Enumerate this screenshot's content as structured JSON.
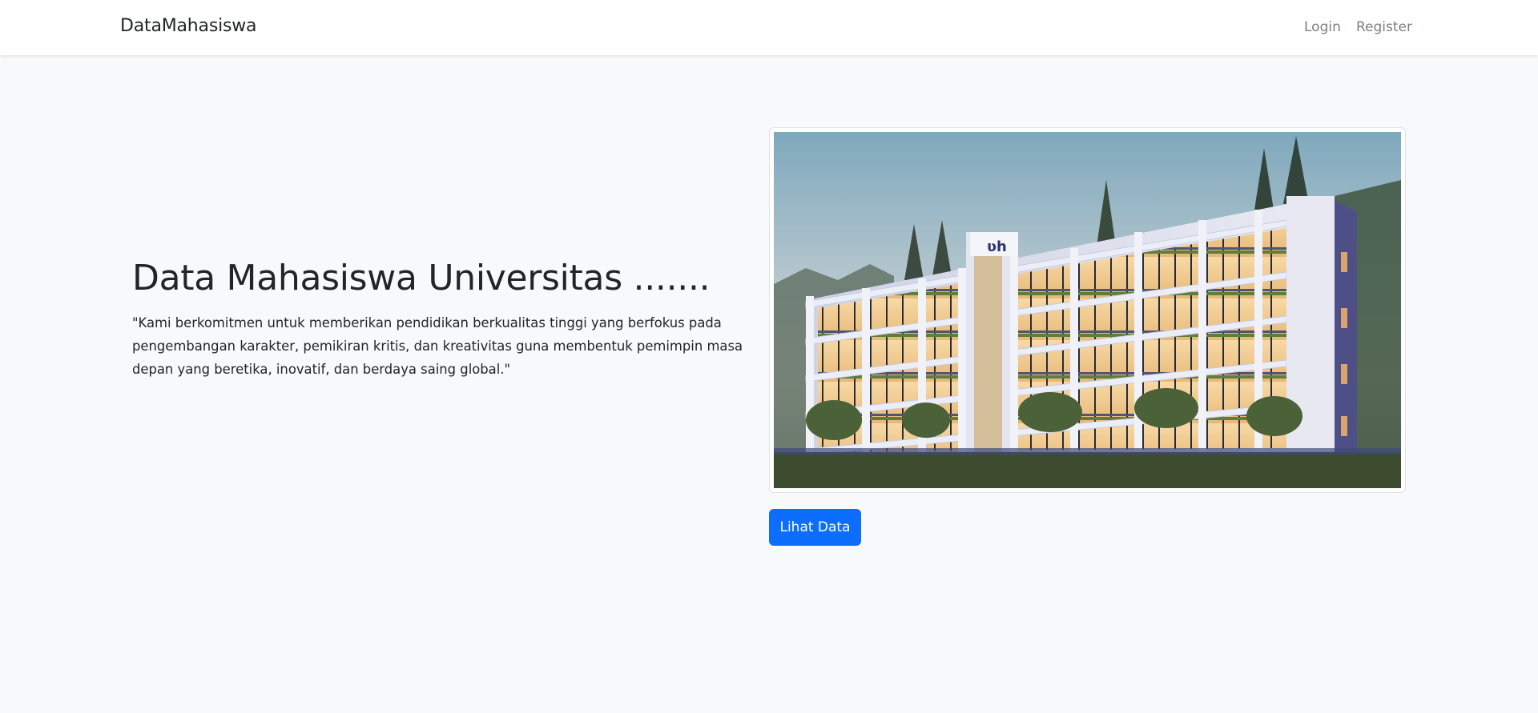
{
  "navbar": {
    "brand": "DataMahasiswa",
    "links": [
      {
        "label": "Login"
      },
      {
        "label": "Register"
      }
    ]
  },
  "hero": {
    "title": "Data Mahasiswa Universitas .......",
    "description": "\"Kami berkomitmen untuk memberikan pendidikan berkualitas tinggi yang berfokus pada pengembangan karakter, pemikiran kritis, dan kreativitas guna membentuk pemimpin masa depan yang beretika, inovatif, dan berdaya saing global.\"",
    "image_icon": "building-photo",
    "button_label": "Lihat Data"
  },
  "colors": {
    "background": "#f8f9fa",
    "primary": "#0d6efd",
    "nav_link": "#7a7f85",
    "text": "#212529"
  }
}
